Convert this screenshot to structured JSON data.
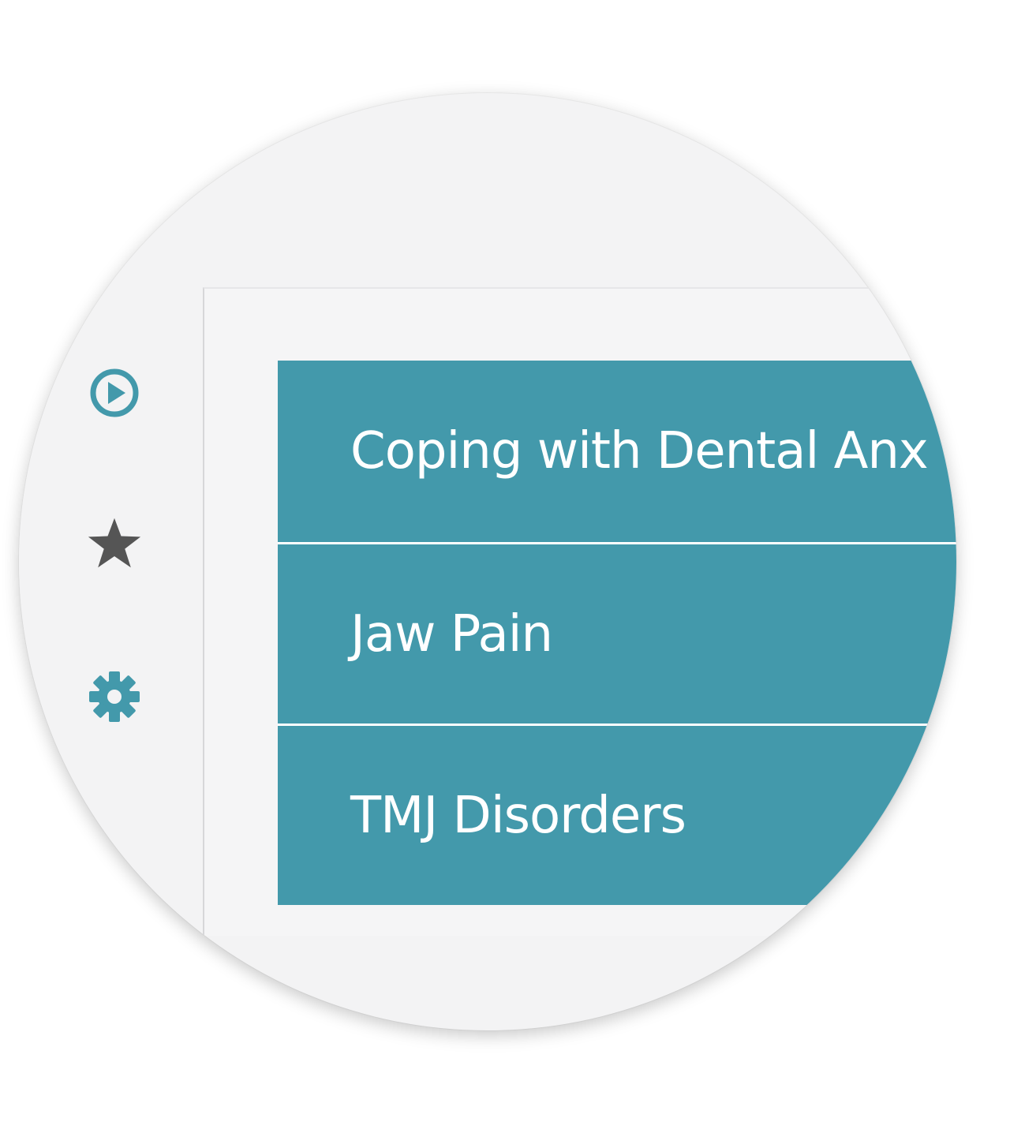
{
  "colors": {
    "accent": "#4399ab",
    "icon_gray": "#555555",
    "background": "#f3f3f4"
  },
  "sidebar": {
    "items": [
      {
        "icon": "play-circle-icon"
      },
      {
        "icon": "star-icon"
      },
      {
        "icon": "gear-icon"
      }
    ]
  },
  "topics": [
    {
      "label": "Coping with Dental Anx"
    },
    {
      "label": "Jaw Pain"
    },
    {
      "label": "TMJ Disorders"
    }
  ]
}
